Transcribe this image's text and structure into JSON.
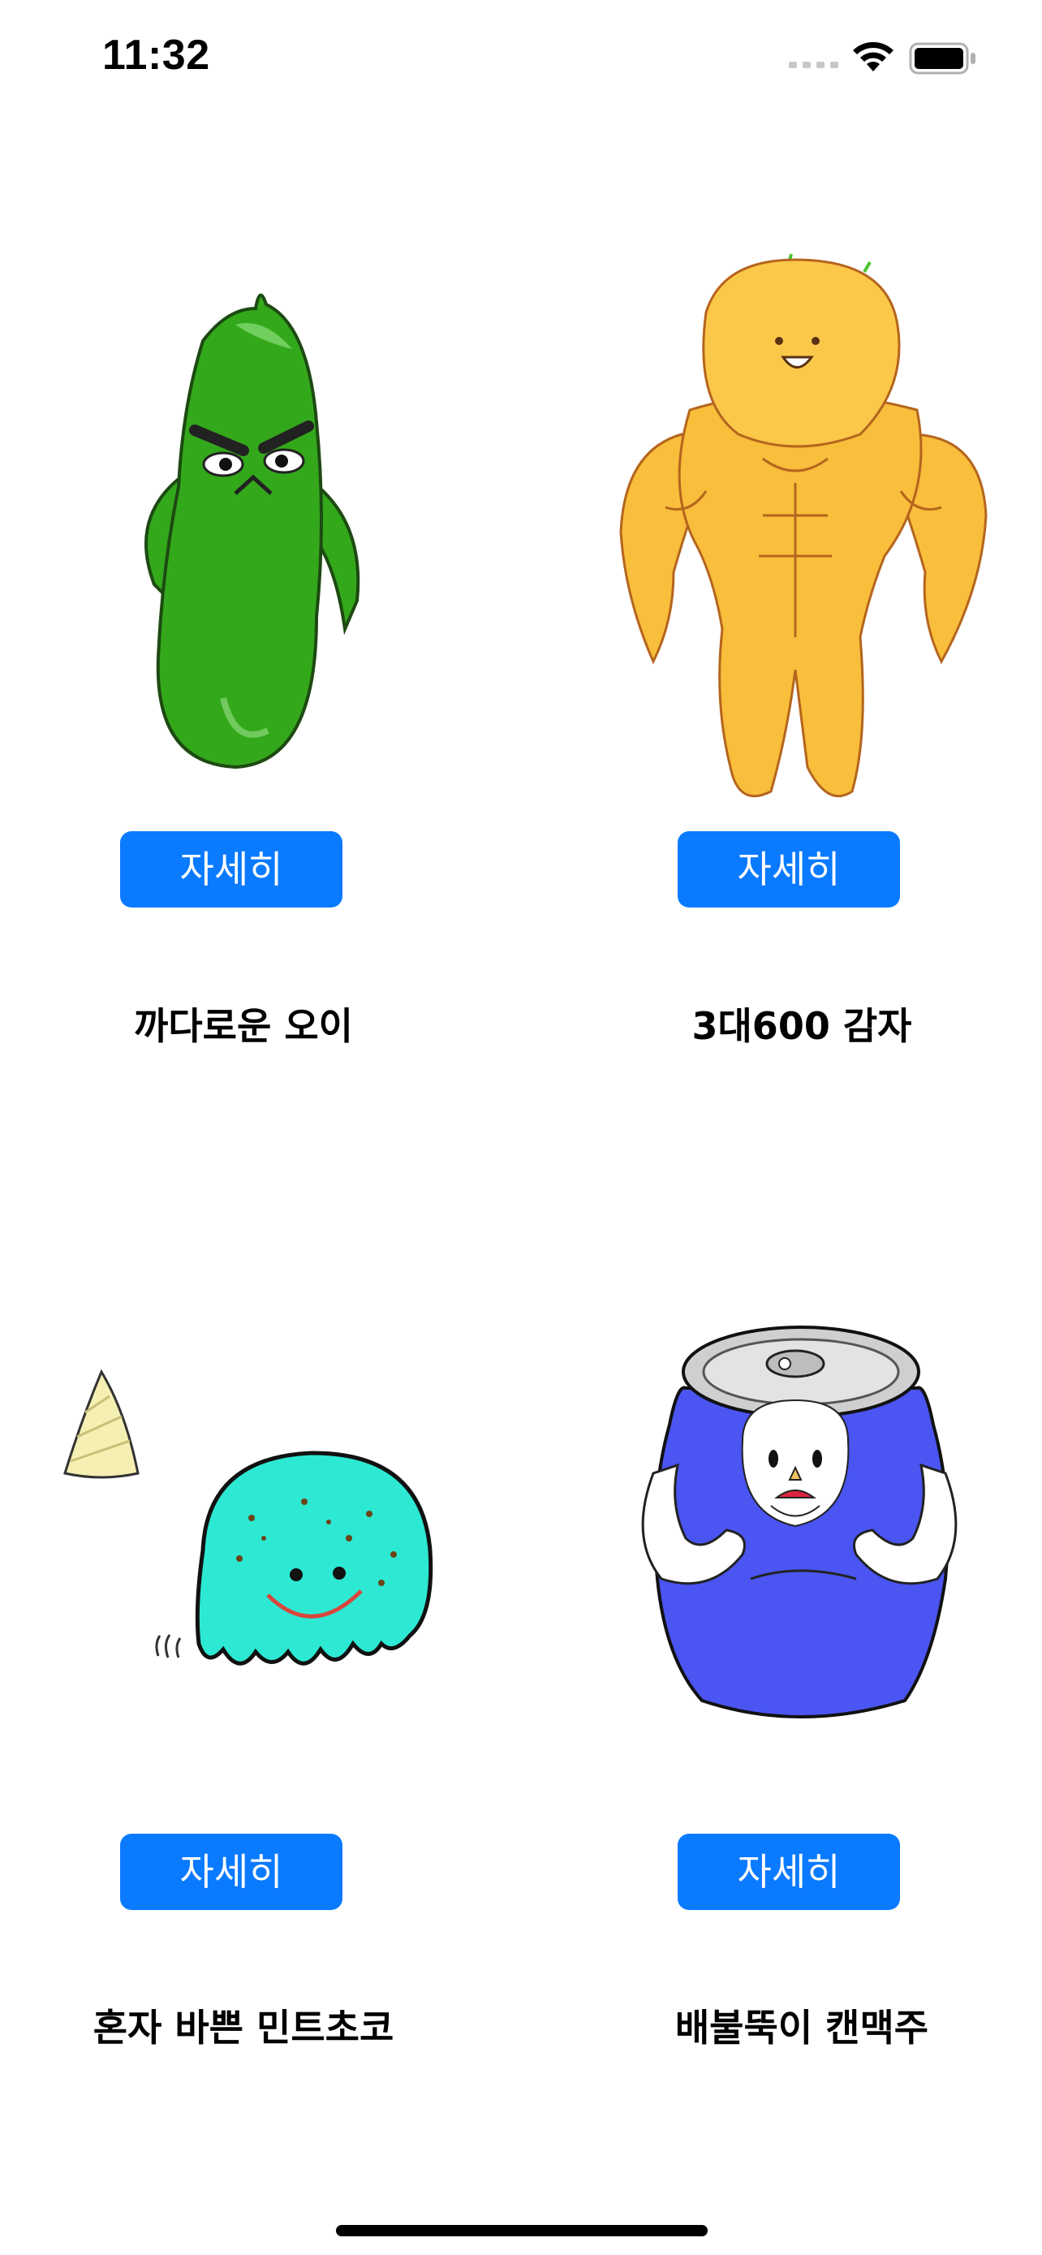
{
  "status_bar": {
    "time": "11:32",
    "signal_icon": "cellular-dots-icon",
    "wifi_icon": "wifi-icon",
    "battery_icon": "battery-icon"
  },
  "items": [
    {
      "name": "까다로운 오이",
      "button_label": "자세히",
      "image_icon": "cucumber-character-image"
    },
    {
      "name": "3대600 감자",
      "button_label": "자세히",
      "image_icon": "muscular-potato-character-image"
    },
    {
      "name": "혼자 바쁜 민트초코",
      "button_label": "자세히",
      "image_icon": "mint-chocolate-blob-character-image"
    },
    {
      "name": "배불뚝이 캔맥주",
      "button_label": "자세히",
      "image_icon": "beer-can-character-image"
    }
  ],
  "colors": {
    "button": "#0a7aff",
    "button_text": "#ffffff",
    "background": "#ffffff"
  }
}
